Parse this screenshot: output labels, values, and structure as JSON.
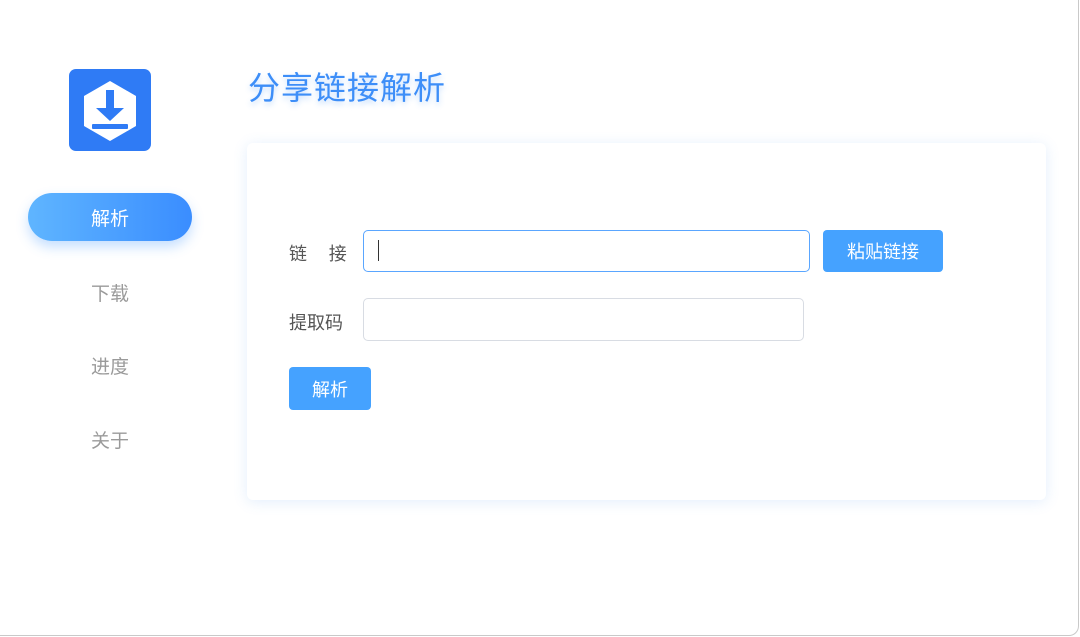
{
  "page_title": "分享链接解析",
  "nav": {
    "items": [
      {
        "label": "解析",
        "active": true
      },
      {
        "label": "下载",
        "active": false
      },
      {
        "label": "进度",
        "active": false
      },
      {
        "label": "关于",
        "active": false
      }
    ]
  },
  "form": {
    "link_label": "链 接",
    "link_value": "",
    "paste_button": "粘贴链接",
    "code_label": "提取码",
    "code_value": "",
    "parse_button": "解析"
  },
  "colors": {
    "accent": "#45a2ff",
    "logo": "#2f7bf5",
    "title": "#3d8ef8"
  },
  "icons": {
    "logo": "download-icon"
  }
}
